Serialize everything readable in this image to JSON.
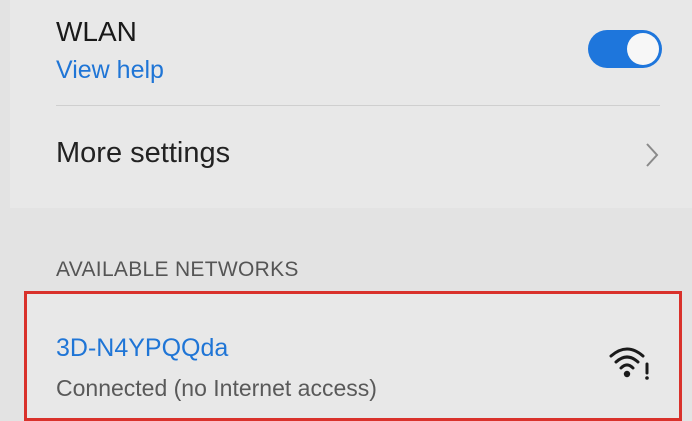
{
  "wlan": {
    "title": "WLAN",
    "help_link": "View help",
    "enabled": true
  },
  "more_settings": {
    "label": "More settings",
    "icon": "chevron-right-icon"
  },
  "available_networks": {
    "header": "AVAILABLE NETWORKS",
    "items": [
      {
        "ssid": "3D-N4YPQQda",
        "status": "Connected (no Internet access)",
        "icon": "wifi-no-internet-icon"
      }
    ]
  },
  "colors": {
    "accent": "#1e76dc",
    "highlight_border": "#d9312b",
    "background": "#e3e3e3"
  }
}
